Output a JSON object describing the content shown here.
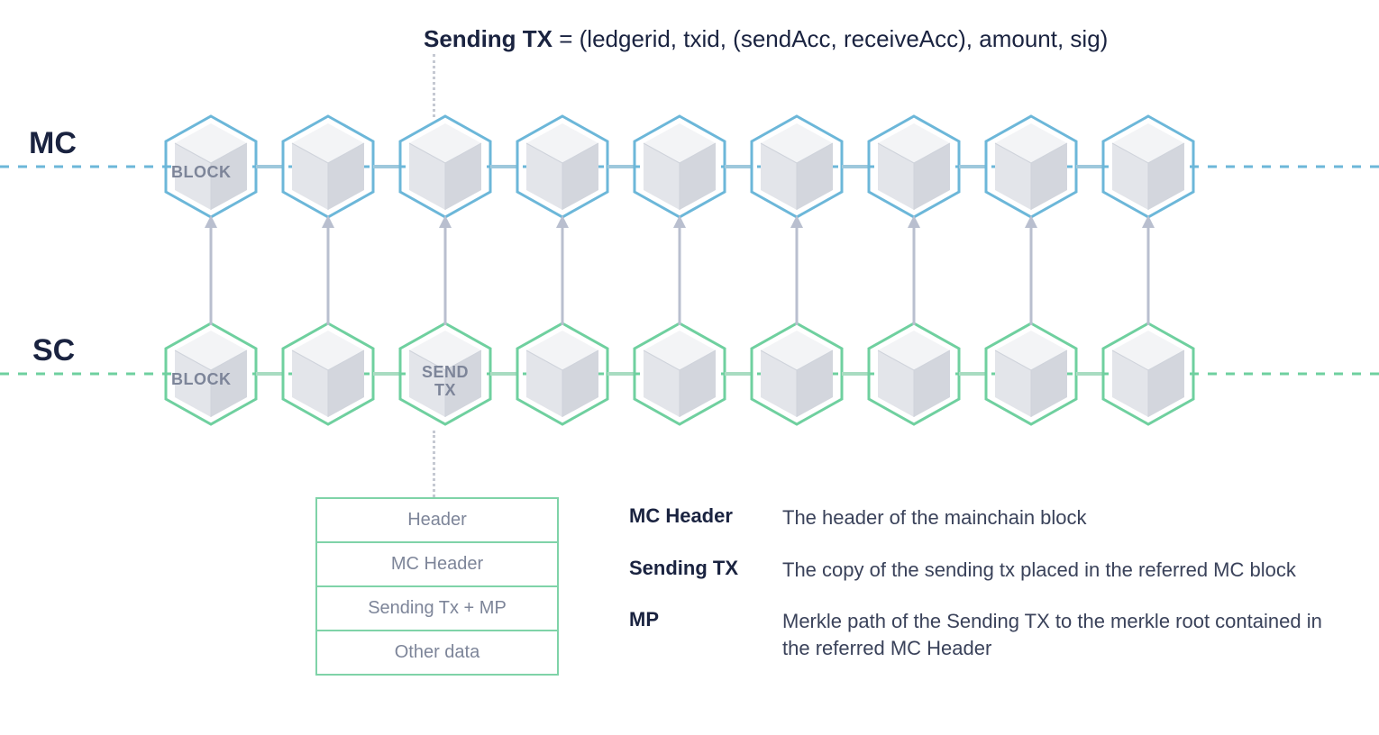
{
  "title": {
    "bold": "Sending TX",
    "rest": " = (ledgerid, txid, (sendAcc, receiveAcc), amount, sig)"
  },
  "chains": {
    "mc": {
      "label": "MC",
      "block_label": "BLOCK"
    },
    "sc": {
      "label": "SC",
      "block_label": "BLOCK",
      "sendtx_label": "SEND\nTX"
    }
  },
  "block_structure": {
    "rows": [
      "Header",
      "MC Header",
      "Sending Tx + MP",
      "Other data"
    ]
  },
  "definitions": [
    {
      "term": "MC Header",
      "desc": "The header of the mainchain block"
    },
    {
      "term": "Sending TX",
      "desc": "The copy of the sending tx placed in the referred MC block"
    },
    {
      "term": "MP",
      "desc": "Merkle path of the Sending TX to the merkle root contained in the referred  MC Header"
    }
  ],
  "colors": {
    "mc_stroke": "#6cb7d9",
    "sc_stroke": "#6fd09f",
    "cube_light": "#f3f4f6",
    "cube_mid": "#e3e5ea",
    "cube_dark": "#d3d6dd",
    "arrow": "#b9bfcf",
    "label_muted": "#7d8599",
    "text_dark": "#1a2340"
  },
  "layout": {
    "num_blocks": 9,
    "sendtx_index": 2
  }
}
